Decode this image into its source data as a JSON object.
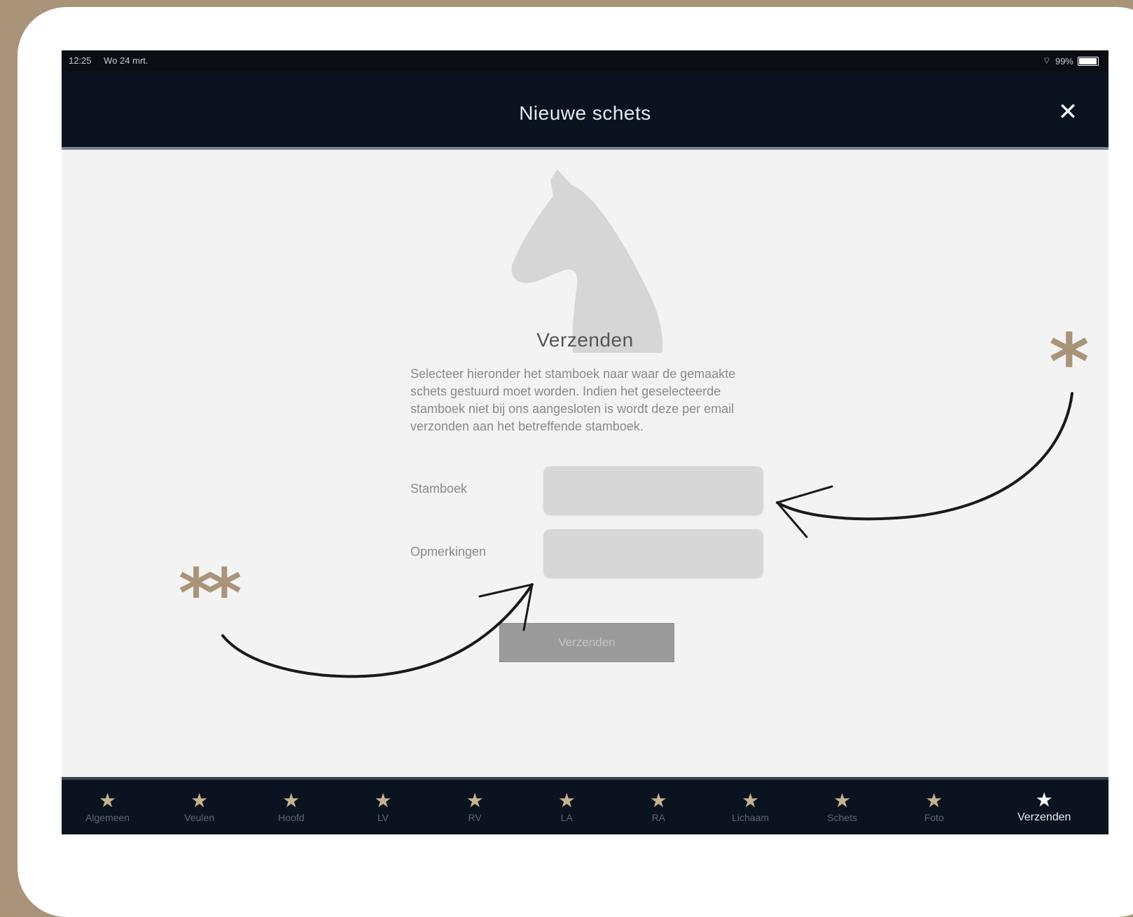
{
  "status_bar": {
    "time": "12:25",
    "date": "Wo 24 mrt.",
    "battery": "99%"
  },
  "header": {
    "title": "Nieuwe schets",
    "close_glyph": "✕"
  },
  "main": {
    "heading": "Verzenden",
    "description": "Selecteer hieronder het stamboek naar waar de gemaakte schets gestuurd moet worden. Indien het geselecteerde stamboek niet bij ons aangesloten is wordt deze per email verzonden aan het betreffende stamboek.",
    "stamboek_label": "Stamboek",
    "stamboek_value": "",
    "opmerkingen_label": "Opmerkingen",
    "opmerkingen_value": "",
    "submit_label": "Verzenden"
  },
  "tabs": [
    {
      "label": "Algemeen",
      "icon": "star-icon"
    },
    {
      "label": "Veulen",
      "icon": "star-icon"
    },
    {
      "label": "Hoofd",
      "icon": "star-icon"
    },
    {
      "label": "LV",
      "icon": "star-icon"
    },
    {
      "label": "RV",
      "icon": "star-icon"
    },
    {
      "label": "LA",
      "icon": "star-icon"
    },
    {
      "label": "RA",
      "icon": "star-icon"
    },
    {
      "label": "Lichaam",
      "icon": "star-icon"
    },
    {
      "label": "Schets",
      "icon": "star-icon"
    },
    {
      "label": "Foto",
      "icon": "star-icon"
    },
    {
      "label": "Verzenden",
      "icon": "star-icon",
      "active": true
    }
  ],
  "annotations": {
    "single": "*",
    "double": "**"
  },
  "colors": {
    "accent": "#a99479",
    "nav_bg": "#0c1320",
    "tab_star": "#c8b38f"
  }
}
